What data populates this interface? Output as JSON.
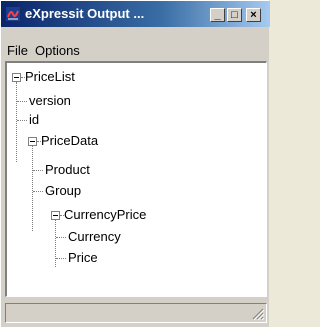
{
  "window": {
    "title": "eXpressit Output ...",
    "app_icon": "app-icon",
    "buttons": {
      "minimize": "_",
      "maximize": "□",
      "close": "×"
    }
  },
  "menu": {
    "items": [
      {
        "label": "File"
      },
      {
        "label": "Options"
      }
    ]
  },
  "tree": {
    "nodes": [
      {
        "label": "PriceList"
      },
      {
        "label": "version"
      },
      {
        "label": "id"
      },
      {
        "label": "PriceData"
      },
      {
        "label": "Product"
      },
      {
        "label": "Group"
      },
      {
        "label": "CurrencyPrice"
      },
      {
        "label": "Currency"
      },
      {
        "label": "Price"
      }
    ]
  },
  "colors": {
    "title_bar_start": "#0a246a",
    "title_bar_end": "#a6caf0",
    "window_face": "#d4d0c8"
  }
}
